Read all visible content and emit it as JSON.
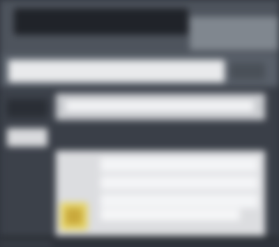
{
  "window": {
    "title": ""
  },
  "toolbar": {
    "address_value": ""
  },
  "sidebar": {
    "items": [
      {
        "label": ""
      },
      {
        "label": ""
      }
    ]
  },
  "content": {
    "header_text": "",
    "rows": [
      {
        "text": ""
      },
      {
        "text": ""
      },
      {
        "text": ""
      }
    ],
    "status_text": "",
    "file_icon": "folder-icon"
  },
  "colors": {
    "background": "#2f343d",
    "titlebar": "#4e545d",
    "address_field": "#e9eaec",
    "panel": "#dcdde0",
    "icon_accent": "#e6d56a"
  }
}
